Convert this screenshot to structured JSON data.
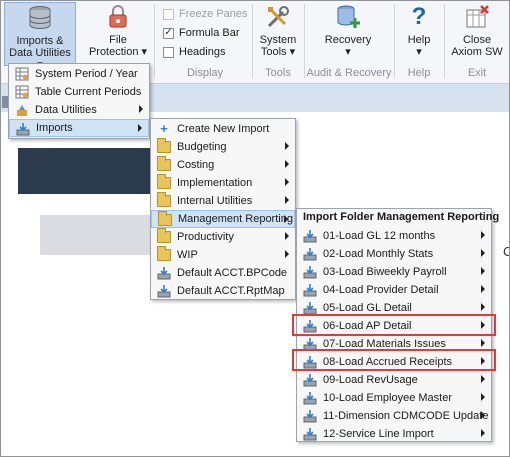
{
  "ribbon": {
    "imports_label_1": "Imports &",
    "imports_label_2": "Data Utilities",
    "file_protection_1": "File",
    "file_protection_2": "Protection",
    "freeze_panes": "Freeze Panes",
    "formula_bar": "Formula Bar",
    "headings": "Headings",
    "display_group": "Display",
    "system_tools_1": "System",
    "system_tools_2": "Tools",
    "tools_group": "Tools",
    "recovery": "Recovery",
    "audit_group": "Audit & Recovery",
    "help": "Help",
    "help_group": "Help",
    "close_1": "Close",
    "close_2": "Axiom SW",
    "exit_group": "Exit"
  },
  "menu1": {
    "items": [
      {
        "label": "System Period / Year"
      },
      {
        "label": "Table Current Periods"
      },
      {
        "label": "Data Utilities"
      },
      {
        "label": "Imports"
      }
    ]
  },
  "menu2": {
    "items": [
      {
        "label": "Create New Import"
      },
      {
        "label": "Budgeting"
      },
      {
        "label": "Costing"
      },
      {
        "label": "Implementation"
      },
      {
        "label": "Internal Utilities"
      },
      {
        "label": "Management Reporting"
      },
      {
        "label": "Productivity"
      },
      {
        "label": "WIP"
      },
      {
        "label": "Default ACCT.BPCode"
      },
      {
        "label": "Default ACCT.RptMap"
      }
    ]
  },
  "menu3": {
    "header": "Import Folder Management Reporting",
    "items": [
      {
        "label": "01-Load GL 12 months"
      },
      {
        "label": "02-Load Monthly Stats"
      },
      {
        "label": "03-Load Biweekly Payroll"
      },
      {
        "label": "04-Load Provider Detail"
      },
      {
        "label": "05-Load GL Detail"
      },
      {
        "label": "06-Load AP Detail"
      },
      {
        "label": "07-Load Materials Issues"
      },
      {
        "label": "08-Load Accrued Receipts"
      },
      {
        "label": "09-Load RevUsage"
      },
      {
        "label": "10-Load Employee Master"
      },
      {
        "label": "11-Dimension CDMCODE Update"
      },
      {
        "label": "12-Service Line Import"
      }
    ]
  },
  "colors": {
    "highlight": "#cfe3f5",
    "callout": "#e03a3a",
    "ribbon_active": "#c5d8ee"
  }
}
